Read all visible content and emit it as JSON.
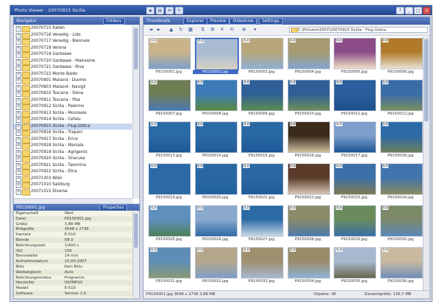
{
  "window": {
    "title": "Photo Viewer - 20070915 Sicilia"
  },
  "tree_pane": {
    "label": "Navigator",
    "tab": "Folders"
  },
  "tree": [
    "20070715 Italien",
    "20070716 Venedig - Lido",
    "20070717 Venedig - Biennale",
    "20070718 Verona",
    "20070719 Gardasee",
    "20070720 Gardasee - Malcesine",
    "20070721 Gardasee - Riva",
    "20070722 Monte Baldo",
    "20070801 Mailand - Duomo",
    "20070803 Mailand - Navigli",
    "20070810 Toscana - Siena",
    "20070811 Toscana - Pisa",
    "20070912 Sicilia - Palermo",
    "20070913 Sicilia - Monreale",
    "20070914 Sicilia - Cefalu",
    "20070915 Sicilia - Flug Ustica",
    "20070916 Sicilia - Trapani",
    "20070917 Sicilia - Erice",
    "20070918 Sicilia - Marsala",
    "20070919 Sicilia - Agrigento",
    "20070920 Sicilia - Siracusa",
    "20070921 Sicilia - Taormina",
    "20070922 Sicilia - Etna",
    "20071003 Wien",
    "20071010 Salzburg",
    "20071015 Diverse"
  ],
  "tree_selected": 15,
  "props_pane": {
    "label": "P9150001.jpg",
    "tab": "Properties"
  },
  "props": [
    {
      "k": "Eigenschaft",
      "v": "Wert"
    },
    {
      "k": "Datei",
      "v": "P9150001.jpg"
    },
    {
      "k": "Größe",
      "v": "3,88 MB"
    },
    {
      "k": "Bildgröße",
      "v": "3648 x 2736"
    },
    {
      "k": "Kamera",
      "v": "E-510"
    },
    {
      "k": "Blende",
      "v": "f/8.0"
    },
    {
      "k": "Belichtungszeit",
      "v": "1/400 s"
    },
    {
      "k": "ISO",
      "v": "100"
    },
    {
      "k": "Brennweite",
      "v": "14 mm"
    },
    {
      "k": "Aufnahmedatum",
      "v": "15.09.2007"
    },
    {
      "k": "Blitz",
      "v": "Kein Blitz"
    },
    {
      "k": "Weißabgleich",
      "v": "Auto"
    },
    {
      "k": "Belichtungsmodus",
      "v": "Programm"
    },
    {
      "k": "Hersteller",
      "v": "OLYMPUS"
    },
    {
      "k": "Modell",
      "v": "E-510"
    },
    {
      "k": "Software",
      "v": "Version 1.0"
    }
  ],
  "browser_pane": {
    "label": "Thumbnails",
    "tabs": [
      "Explorer",
      "Preview",
      "Slideshow",
      "Settings"
    ]
  },
  "toolbar_icons": [
    "back-icon",
    "forward-icon",
    "up-folder-icon",
    "refresh-icon",
    "view-icon",
    "sort-icon",
    "copy-icon",
    "delete-icon",
    "rotate-icon",
    "zoom-icon"
  ],
  "path": "C:\\Pictures\\2007\\20070915 Sicilia - Flug Ustica",
  "thumbs": [
    {
      "name": "P9150001.jpg",
      "num": "0.0"
    },
    {
      "name": "P9150002.jpg",
      "num": "0.0"
    },
    {
      "name": "P9150003.jpg",
      "num": "0.0"
    },
    {
      "name": "P9150004.jpg",
      "num": "0.0"
    },
    {
      "name": "P9150005.jpg",
      "num": "0.0"
    },
    {
      "name": "P9150006.jpg",
      "num": "0.0"
    },
    {
      "name": "P9150007.jpg",
      "num": "0.0"
    },
    {
      "name": "P9150008.jpg",
      "num": "0.0"
    },
    {
      "name": "P9150009.jpg",
      "num": "0.0"
    },
    {
      "name": "P9150010.jpg",
      "num": "0.0"
    },
    {
      "name": "P9150011.jpg",
      "num": "0.0"
    },
    {
      "name": "P9150012.jpg",
      "num": "0.0"
    },
    {
      "name": "P9150013.jpg",
      "num": "0.0"
    },
    {
      "name": "P9150014.jpg",
      "num": "0.0"
    },
    {
      "name": "P9150015.jpg",
      "num": "0.0"
    },
    {
      "name": "P9150016.jpg",
      "num": "0.0"
    },
    {
      "name": "P9150017.jpg",
      "num": "0.0"
    },
    {
      "name": "P9150018.jpg",
      "num": "0.0"
    },
    {
      "name": "P9150019.jpg",
      "num": "0.0"
    },
    {
      "name": "P9150020.jpg",
      "num": "0.0"
    },
    {
      "name": "P9150021.jpg",
      "num": "0.0"
    },
    {
      "name": "P9150022.jpg",
      "num": "0.0"
    },
    {
      "name": "P9150023.jpg",
      "num": "0.0"
    },
    {
      "name": "P9150024.jpg",
      "num": "0.0"
    },
    {
      "name": "P9150025.jpg",
      "num": "0.0"
    },
    {
      "name": "P9150026.jpg",
      "num": "0.0"
    },
    {
      "name": "P9150027.jpg",
      "num": "0.0"
    },
    {
      "name": "P9150028.jpg",
      "num": "0.0"
    },
    {
      "name": "P9150029.jpg",
      "num": "0.0"
    },
    {
      "name": "P9150030.jpg",
      "num": "0.0"
    },
    {
      "name": "P9150031.jpg",
      "num": "0.0"
    },
    {
      "name": "P9150032.jpg",
      "num": "0.0"
    },
    {
      "name": "P9150033.jpg",
      "num": "0.0"
    },
    {
      "name": "P9150034.jpg",
      "num": "0.0"
    },
    {
      "name": "P9150035.jpg",
      "num": "0.0"
    },
    {
      "name": "P9150036.jpg",
      "num": "0.0"
    }
  ],
  "thumb_selected": 1,
  "thumb_colors": [
    [
      "#c9b48a",
      "#7ea0c9"
    ],
    [
      "#a9bcd2",
      "#d7d2c2"
    ],
    [
      "#b9a57a",
      "#8fb0d6"
    ],
    [
      "#a59a70",
      "#84a6cf"
    ],
    [
      "#8a4b86",
      "#f0e0c8"
    ],
    [
      "#b07a2a",
      "#e8e2d6"
    ],
    [
      "#6f7d55",
      "#4a79b4"
    ],
    [
      "#3c7bb8",
      "#5a8a3f"
    ],
    [
      "#2e5f98",
      "#5d8c4e"
    ],
    [
      "#2e5f98",
      "#6f8e5a"
    ],
    [
      "#2a5e9c",
      "#1d4f8c"
    ],
    [
      "#3a6ca8",
      "#7a8f5f"
    ],
    [
      "#2a6aa6",
      "#1e5796"
    ],
    [
      "#2a6aa6",
      "#245b99"
    ],
    [
      "#2869a4",
      "#1f5898"
    ],
    [
      "#3a2a1c",
      "#cfc1a0"
    ],
    [
      "#7c9fcc",
      "#1f5594"
    ],
    [
      "#2d6aa8",
      "#6c7e5a"
    ],
    [
      "#2b6aa6",
      "#2c6aa5"
    ],
    [
      "#2a68a3",
      "#2262a0"
    ],
    [
      "#2b67a1",
      "#1f5c99"
    ],
    [
      "#5a3a28",
      "#d8c8b8"
    ],
    [
      "#3b70a9",
      "#7f7a52"
    ],
    [
      "#3f74ad",
      "#8b8a5c"
    ],
    [
      "#5e8fbd",
      "#4f7f57"
    ],
    [
      "#8aa9cc",
      "#2e6aa5"
    ],
    [
      "#2c6aa6",
      "#c7d8e4"
    ],
    [
      "#8b8a69",
      "#4f79ab"
    ],
    [
      "#6a8b5c",
      "#3a70a8"
    ],
    [
      "#7c8a6a",
      "#5c88b8"
    ],
    [
      "#5e8db6",
      "#8a9a72"
    ],
    [
      "#b5a78c",
      "#7f9fc6"
    ],
    [
      "#9e8f6e",
      "#a6b9d1"
    ],
    [
      "#9a8c6a",
      "#8fb2d5"
    ],
    [
      "#a8b9cf",
      "#6a6550"
    ],
    [
      "#c9b9a0",
      "#6f8fb8"
    ]
  ],
  "status": {
    "left": "P9150001.jpg   3648 x 2736   3,88 MB",
    "mid": "Objekte: 36",
    "right": "Gesamtgröße: 139,7 MB"
  }
}
